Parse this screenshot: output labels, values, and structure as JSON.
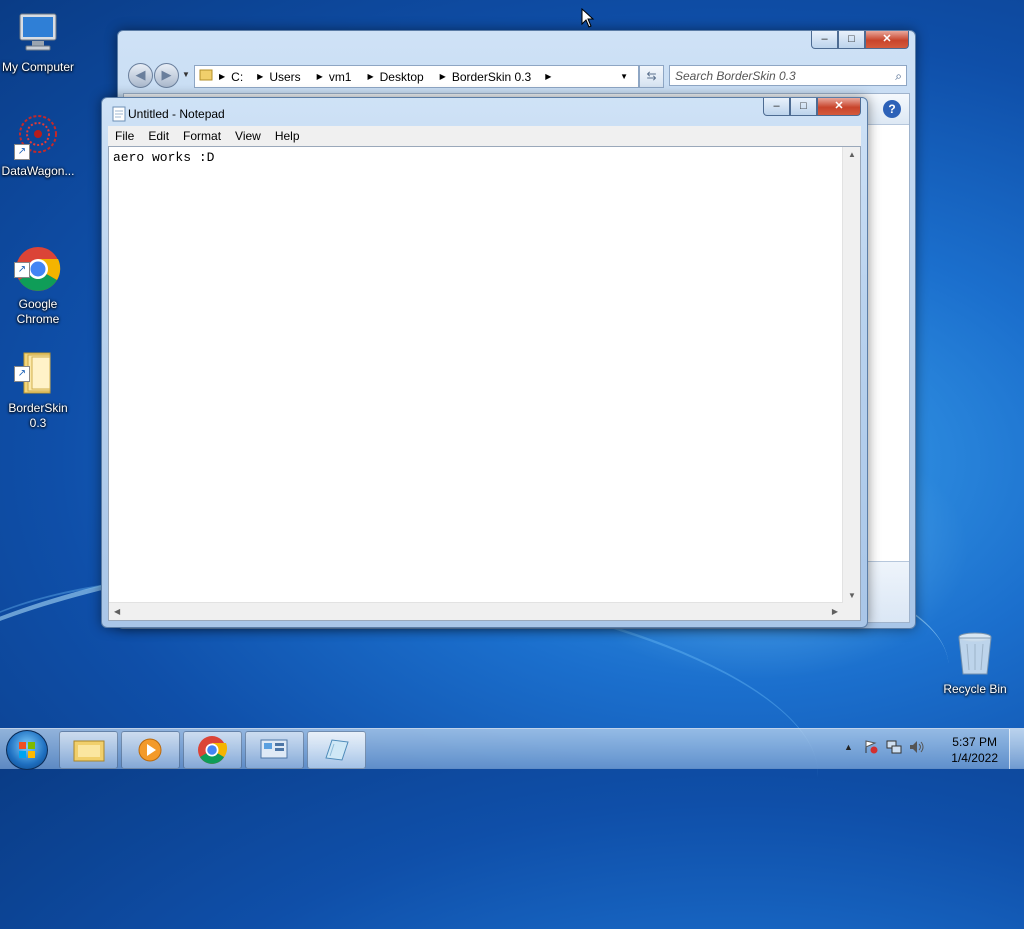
{
  "desktop": {
    "icons": [
      {
        "label": "My Computer"
      },
      {
        "label": "DataWagon..."
      },
      {
        "label": "Google\nChrome"
      },
      {
        "label": "BorderSkin\n0.3"
      },
      {
        "label": "Recycle Bin"
      }
    ]
  },
  "explorer": {
    "breadcrumbs": [
      "C:",
      "Users",
      "vm1",
      "Desktop",
      "BorderSkin 0.3"
    ],
    "search_placeholder": "Search BorderSkin 0.3"
  },
  "notepad": {
    "title": "Untitled - Notepad",
    "menu": [
      "File",
      "Edit",
      "Format",
      "View",
      "Help"
    ],
    "content": "aero works :D"
  },
  "window_controls": {
    "minimize": "–",
    "maximize": "□",
    "close": "✕"
  },
  "taskbar": {
    "clock_time": "5:37 PM",
    "clock_date": "1/4/2022",
    "tray_overflow": "▲"
  }
}
